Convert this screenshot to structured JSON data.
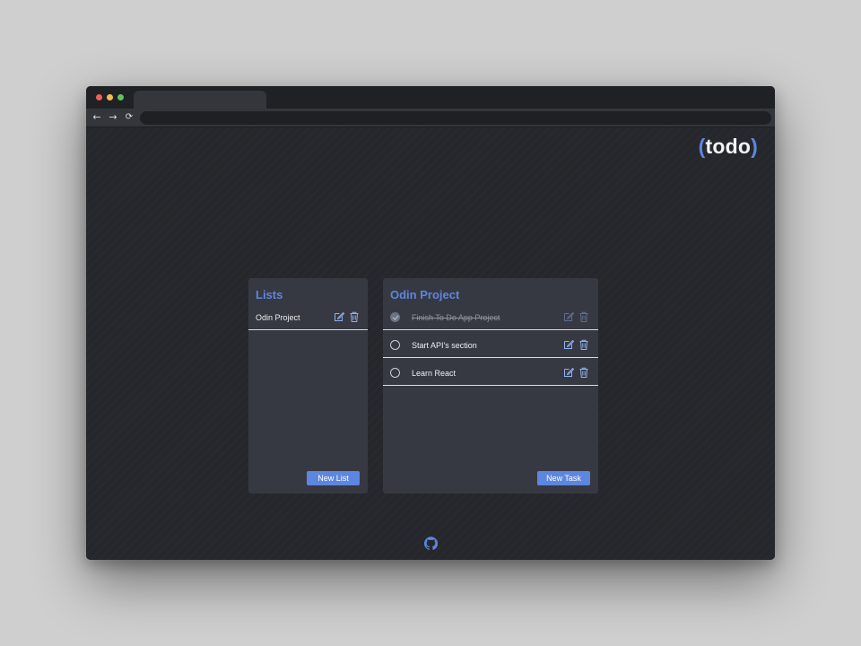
{
  "browser": {
    "url": "",
    "nav": {
      "back": "←",
      "forward": "→",
      "reload": "⟳"
    }
  },
  "app": {
    "logo_open": "(",
    "logo_text": "todo",
    "logo_close": ")",
    "accent_color": "#5c86e0"
  },
  "lists_panel": {
    "title": "Lists",
    "items": [
      {
        "label": "Odin Project"
      }
    ],
    "new_button": "New List"
  },
  "tasks_panel": {
    "title": "Odin Project",
    "items": [
      {
        "label": "Finish To Do App Project",
        "completed": true
      },
      {
        "label": "Start API's section",
        "completed": false
      },
      {
        "label": "Learn React",
        "completed": false
      }
    ],
    "new_button": "New Task"
  },
  "footer": {
    "icon": "github-icon"
  }
}
